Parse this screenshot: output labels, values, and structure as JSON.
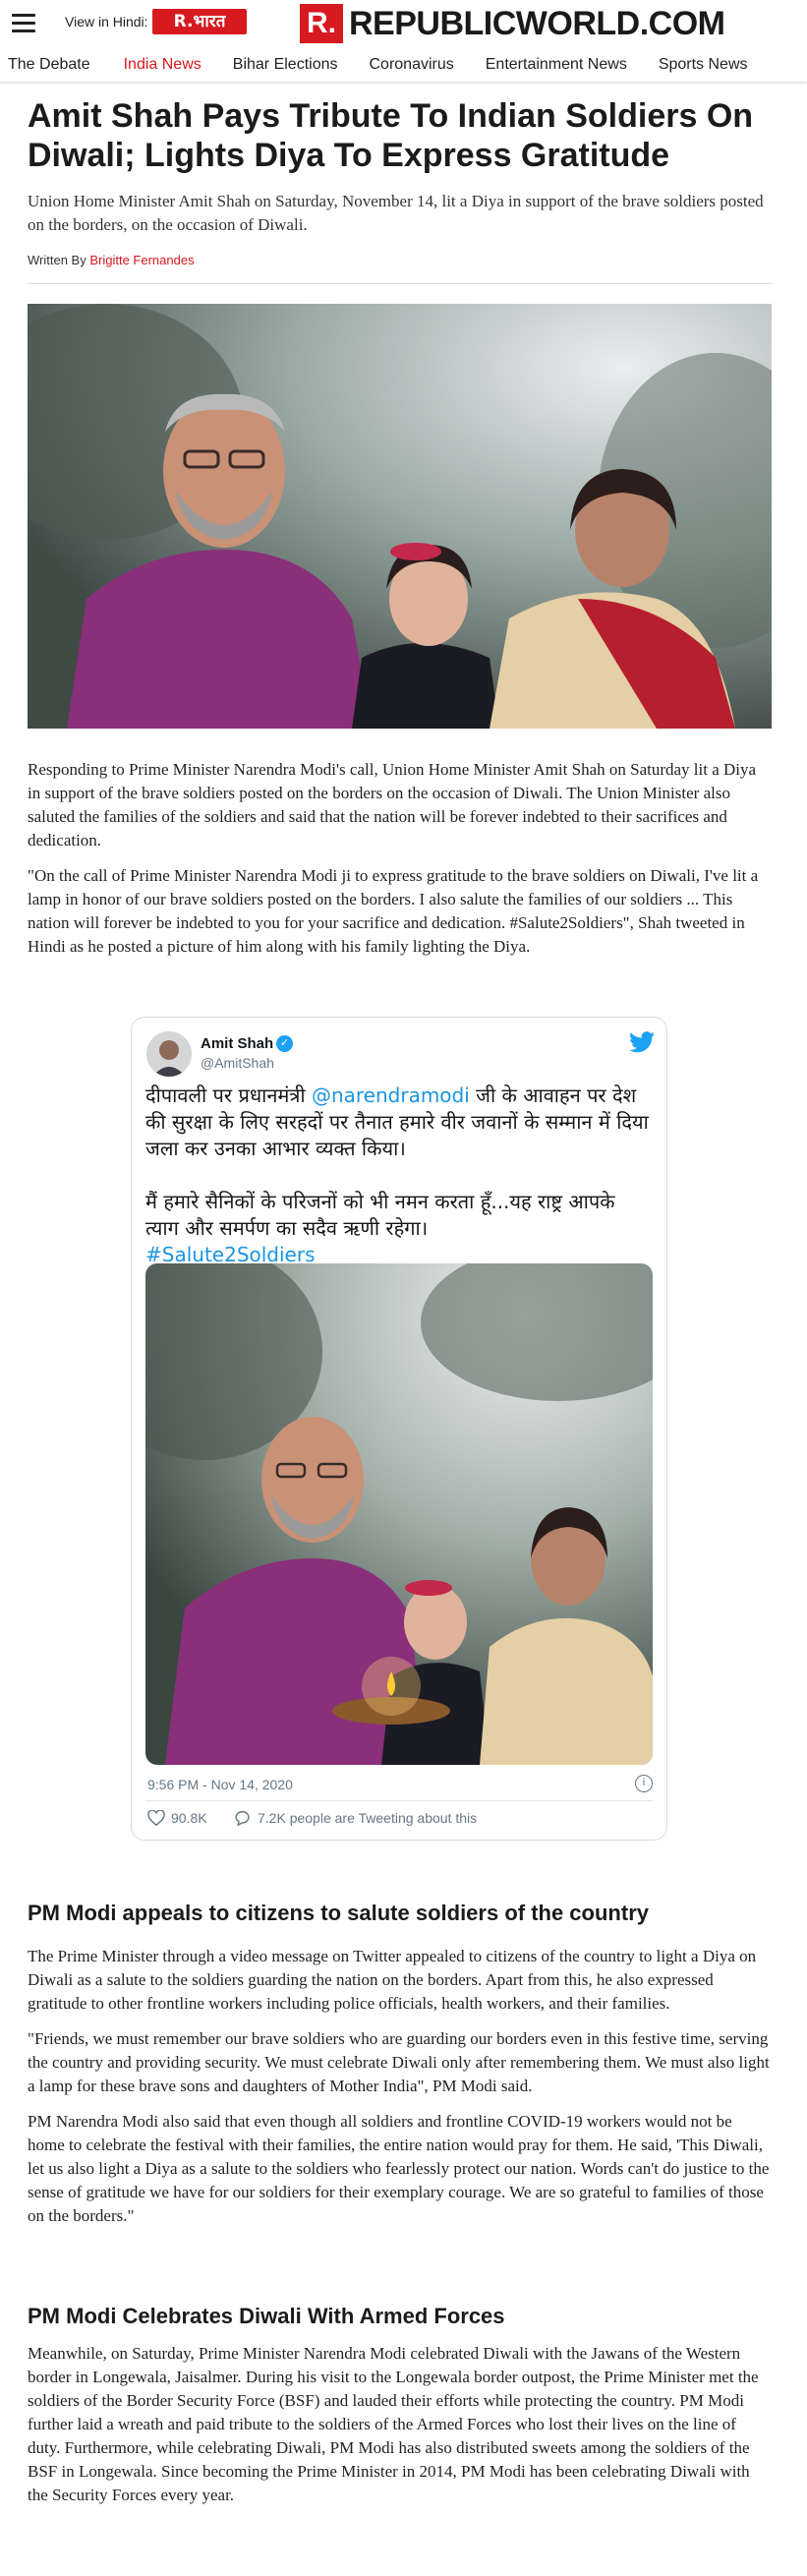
{
  "header": {
    "view_in_hindi_label": "View in Hindi:",
    "hindi_brand": "R.भारत",
    "brand_mark": "R.",
    "brand_name": "REPUBLICWORLD.COM",
    "accent_color": "#d71920"
  },
  "nav": {
    "items": [
      {
        "label": "The Debate",
        "active": false
      },
      {
        "label": "India News",
        "active": true
      },
      {
        "label": "Bihar Elections",
        "active": false
      },
      {
        "label": "Coronavirus",
        "active": false
      },
      {
        "label": "Entertainment News",
        "active": false
      },
      {
        "label": "Sports News",
        "active": false
      }
    ]
  },
  "article": {
    "title": "Amit Shah Pays Tribute To Indian Soldiers On Diwali; Lights Diya To Express Gratitude",
    "dek": "Union Home Minister Amit Shah on Saturday, November 14, lit a Diya in support of the brave soldiers posted on the borders, on the occasion of Diwali.",
    "byline_prefix": "Written By",
    "author": "Brigitte Fernandes",
    "paragraph_1": "Responding to Prime Minister Narendra Modi's call, Union Home Minister Amit Shah on Saturday lit a Diya in support of the brave soldiers posted on the borders on the occasion of Diwali. The Union Minister also saluted the families of the soldiers and said that the nation will be forever indebted to their sacrifices and dedication.",
    "paragraph_2": "\"On the call of Prime Minister Narendra Modi ji to express gratitude to the brave soldiers on Diwali, I've lit a lamp in honor of our brave soldiers posted on the borders. I also salute the families of our soldiers ... This nation will forever be indebted to you for your sacrifice and dedication. #Salute2Soldiers\", Shah tweeted in Hindi as he posted a picture of him along with his family lighting the Diya."
  },
  "tweet": {
    "name": "Amit Shah",
    "handle": "@AmitShah",
    "text_part1": "दीपावली पर प्रधानमंत्री ",
    "mention": "@narendramodi",
    "text_part2": " जी के आवाहन पर देश की सुरक्षा के लिए सरहदों पर तैनात हमारे वीर जवानों के सम्मान में दिया जला कर उनका आभार व्यक्त किया।",
    "text_part3": "मैं हमारे सैनिकों के परिजनों को भी नमन करता हूँ...यह राष्ट्र आपके त्याग और समर्पण का सदैव ऋणी रहेगा।",
    "hashtag": "#Salute2Soldiers",
    "timestamp": "9:56 PM - Nov 14, 2020",
    "likes": "90.8K",
    "tweeting_about": "7.2K people are Tweeting about this",
    "link_color": "#1b95e0"
  },
  "section_1": {
    "heading": "PM Modi appeals to citizens to salute soldiers of the country",
    "paragraph_1": "The Prime Minister through a video message on Twitter appealed to citizens of the country to light a Diya on Diwali as a salute to the soldiers guarding the nation on the borders. Apart from this, he also expressed gratitude to other frontline workers including police officials, health workers, and their families.",
    "paragraph_2": "\"Friends, we must remember our brave soldiers who are guarding our borders even in this festive time, serving the country and providing security. We must celebrate Diwali only after remembering them. We must also light a lamp for these brave sons and daughters of Mother India\", PM Modi said.",
    "paragraph_3": "PM Narendra Modi also said that even though all soldiers and frontline COVID-19 workers would not be home to celebrate the festival with their families, the entire nation would pray for them. He said, 'This Diwali, let us also light a Diya as a salute to the soldiers who fearlessly protect our nation. Words can't do justice to the sense of gratitude we have for our soldiers for their exemplary courage. We are so grateful to families of those on the borders.\""
  },
  "section_2": {
    "heading": "PM Modi Celebrates Diwali With Armed Forces",
    "paragraph_1": "Meanwhile, on Saturday, Prime Minister Narendra Modi celebrated Diwali with the Jawans of the Western border in Longewala, Jaisalmer. During his visit to the Longewala border outpost, the Prime Minister met the soldiers of the Border Security Force (BSF) and lauded their efforts while protecting the country. PM Modi further laid a wreath and paid tribute to the soldiers of the Armed Forces who lost their lives on the line of duty. Furthermore, while celebrating Diwali, PM Modi has also distributed sweets among the soldiers of the BSF in Longewala. Since becoming the Prime Minister in 2014, PM Modi has been celebrating Diwali with the Security Forces every year."
  }
}
